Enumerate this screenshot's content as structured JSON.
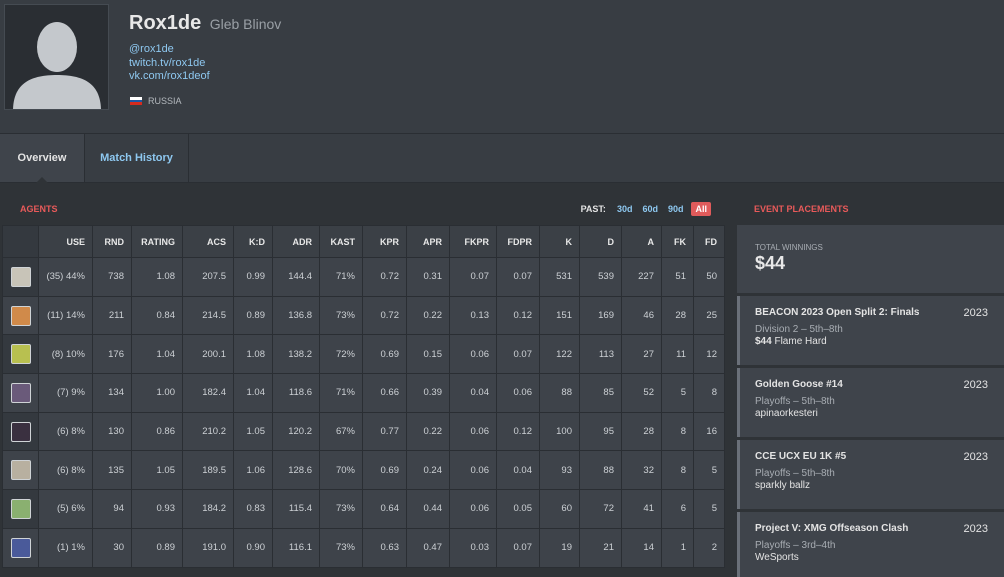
{
  "profile": {
    "handle": "Rox1de",
    "real_name": "Gleb Blinov",
    "links": [
      "@rox1de",
      "twitch.tv/rox1de",
      "vk.com/rox1deof"
    ],
    "country": "RUSSIA"
  },
  "tabs": [
    "Overview",
    "Match History"
  ],
  "agents": {
    "title": "AGENTS",
    "past_label": "PAST:",
    "past_options": [
      "30d",
      "60d",
      "90d",
      "All"
    ],
    "columns": [
      "USE",
      "RND",
      "RATING",
      "ACS",
      "K:D",
      "ADR",
      "KAST",
      "KPR",
      "APR",
      "FKPR",
      "FDPR",
      "K",
      "D",
      "A",
      "FK",
      "FD"
    ],
    "rows": [
      [
        "(35) 44%",
        "738",
        "1.08",
        "207.5",
        "0.99",
        "144.4",
        "71%",
        "0.72",
        "0.31",
        "0.07",
        "0.07",
        "531",
        "539",
        "227",
        "51",
        "50"
      ],
      [
        "(11) 14%",
        "211",
        "0.84",
        "214.5",
        "0.89",
        "136.8",
        "73%",
        "0.72",
        "0.22",
        "0.13",
        "0.12",
        "151",
        "169",
        "46",
        "28",
        "25"
      ],
      [
        "(8) 10%",
        "176",
        "1.04",
        "200.1",
        "1.08",
        "138.2",
        "72%",
        "0.69",
        "0.15",
        "0.06",
        "0.07",
        "122",
        "113",
        "27",
        "11",
        "12"
      ],
      [
        "(7) 9%",
        "134",
        "1.00",
        "182.4",
        "1.04",
        "118.6",
        "71%",
        "0.66",
        "0.39",
        "0.04",
        "0.06",
        "88",
        "85",
        "52",
        "5",
        "8"
      ],
      [
        "(6) 8%",
        "130",
        "0.86",
        "210.2",
        "1.05",
        "120.2",
        "67%",
        "0.77",
        "0.22",
        "0.06",
        "0.12",
        "100",
        "95",
        "28",
        "8",
        "16"
      ],
      [
        "(6) 8%",
        "135",
        "1.05",
        "189.5",
        "1.06",
        "128.6",
        "70%",
        "0.69",
        "0.24",
        "0.06",
        "0.04",
        "93",
        "88",
        "32",
        "8",
        "5"
      ],
      [
        "(5) 6%",
        "94",
        "0.93",
        "184.2",
        "0.83",
        "115.4",
        "73%",
        "0.64",
        "0.44",
        "0.06",
        "0.05",
        "60",
        "72",
        "41",
        "6",
        "5"
      ],
      [
        "(1) 1%",
        "30",
        "0.89",
        "191.0",
        "0.90",
        "116.1",
        "73%",
        "0.63",
        "0.47",
        "0.03",
        "0.07",
        "19",
        "21",
        "14",
        "1",
        "2"
      ]
    ],
    "agent_icon_colors": [
      "#c8c4b8",
      "#d08a4a",
      "#b8c050",
      "#6a5a7a",
      "#3a3040",
      "#b8b0a0",
      "#8ab070",
      "#4a5a9a"
    ]
  },
  "events": {
    "title": "EVENT PLACEMENTS",
    "total_label": "TOTAL WINNINGS",
    "total_value": "$44",
    "items": [
      {
        "name": "BEACON 2023 Open Split 2: Finals",
        "year": "2023",
        "placement": "Division 2 – 5th–8th",
        "prize": "$44",
        "team": "Flame Hard"
      },
      {
        "name": "Golden Goose #14",
        "year": "2023",
        "placement": "Playoffs – 5th–8th",
        "prize": "",
        "team": "apinaorkesteri"
      },
      {
        "name": "CCE UCX EU 1K #5",
        "year": "2023",
        "placement": "Playoffs – 5th–8th",
        "prize": "",
        "team": "sparkly ballz"
      },
      {
        "name": "Project V: XMG Offseason Clash",
        "year": "2023",
        "placement": "Playoffs – 3rd–4th",
        "prize": "",
        "team": "WeSports"
      }
    ]
  },
  "colors": {
    "accent_red": "#e85a5a",
    "link_blue": "#8ec8f0",
    "background": "#2f3337"
  }
}
